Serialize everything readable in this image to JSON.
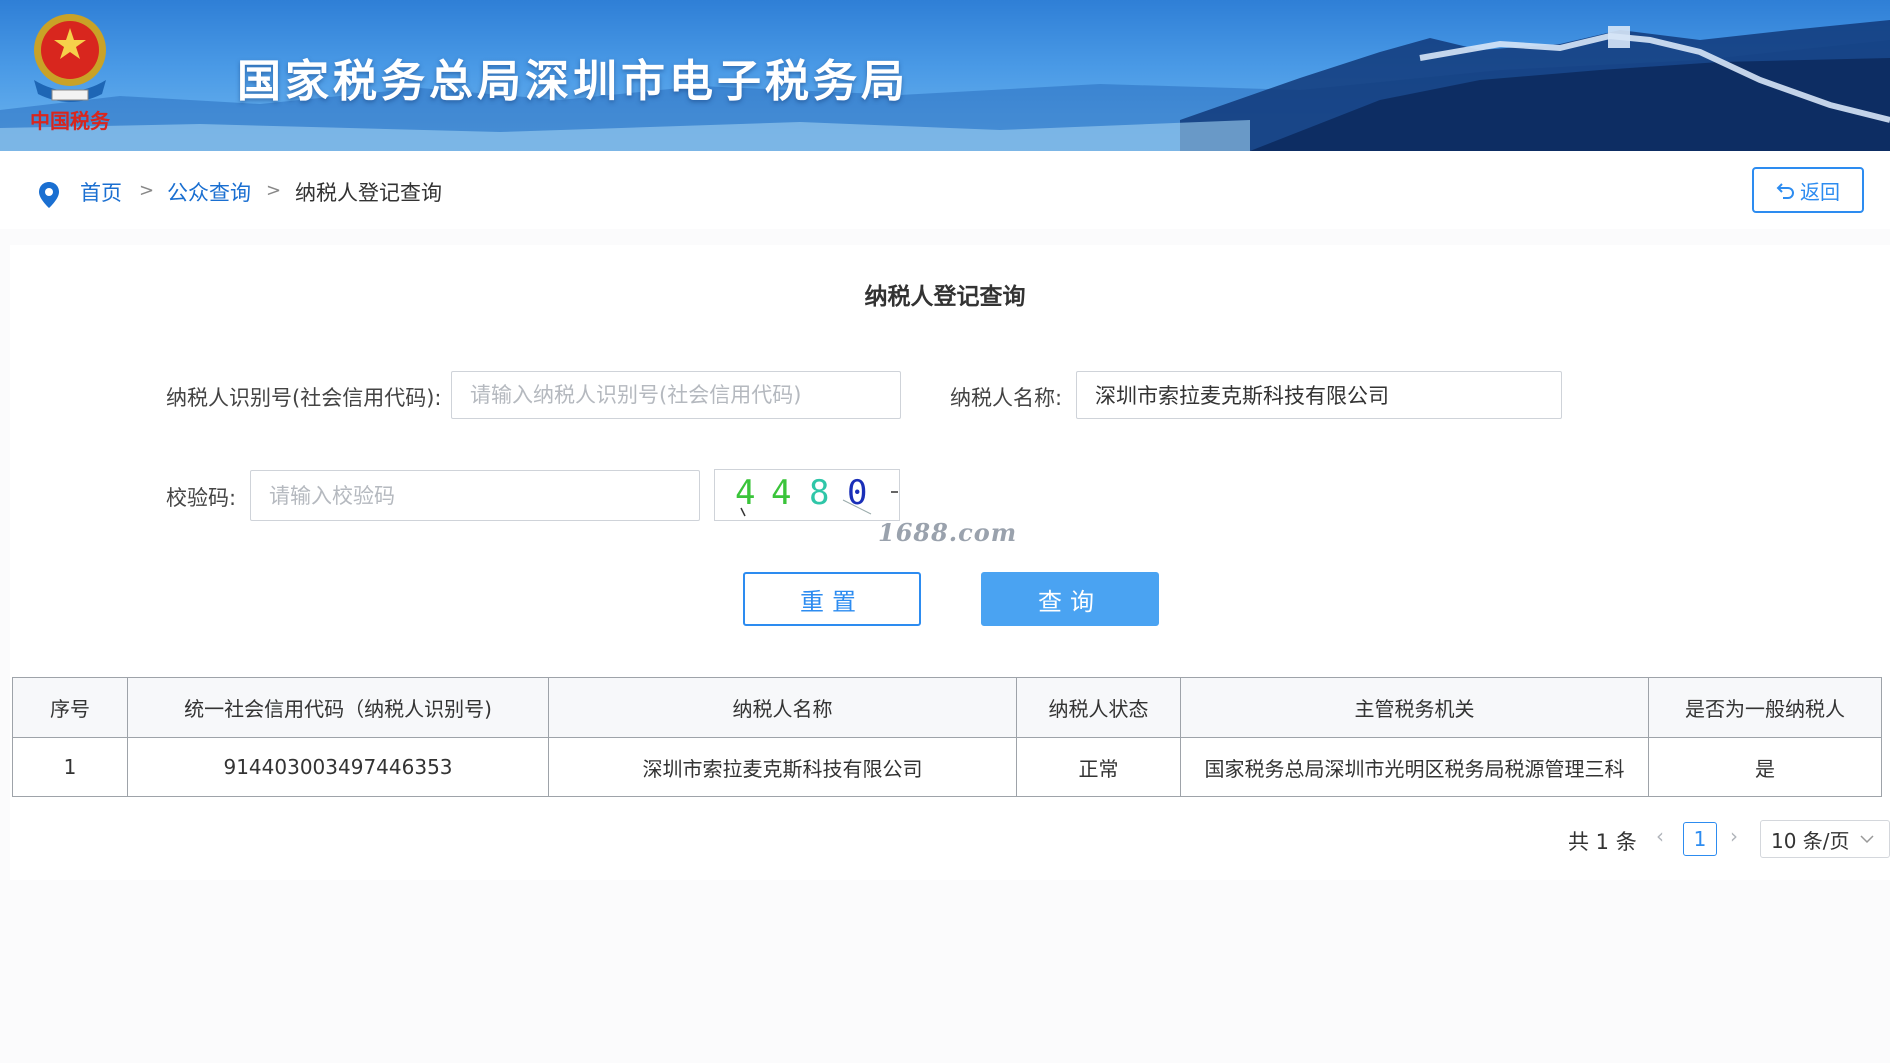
{
  "header": {
    "site_title": "国家税务总局深圳市电子税务局",
    "logo_text": "中国税务"
  },
  "breadcrumb": {
    "home": "首页",
    "separator": ">",
    "public_query": "公众查询",
    "current": "纳税人登记查询"
  },
  "back_button": {
    "label": "返回",
    "icon": "undo-arrow-icon"
  },
  "form": {
    "title": "纳税人登记查询",
    "taxpayer_id": {
      "label": "纳税人识别号(社会信用代码):",
      "placeholder": "请输入纳税人识别号(社会信用代码)",
      "value": ""
    },
    "taxpayer_name": {
      "label": "纳税人名称:",
      "placeholder": "",
      "value": "深圳市索拉麦克斯科技有限公司"
    },
    "captcha": {
      "label": "校验码:",
      "placeholder": "请输入校验码",
      "value": "",
      "image_digits": [
        "4",
        "4",
        "8",
        "0"
      ],
      "digit_colors": [
        "#3ac43a",
        "#3ac43a",
        "#2fc6a8",
        "#1a2fb8"
      ]
    },
    "watermark": "1688.com",
    "reset_label": "重置",
    "query_label": "查询"
  },
  "table": {
    "columns": [
      "序号",
      "统一社会信用代码（纳税人识别号)",
      "纳税人名称",
      "纳税人状态",
      "主管税务机关",
      "是否为一般纳税人"
    ],
    "rows": [
      [
        "1",
        "914403003497446353",
        "深圳市索拉麦克斯科技有限公司",
        "正常",
        "国家税务总局深圳市光明区税务局税源管理三科",
        "是"
      ]
    ]
  },
  "pagination": {
    "total_text": "共 1 条",
    "current_page": "1",
    "page_size": "10 条/页",
    "prev_icon": "chevron-left-icon",
    "next_icon": "chevron-right-icon"
  },
  "colors": {
    "accent": "#2d8cf0",
    "query_button": "#4aa3f2",
    "link": "#1a6fd1",
    "banner": "#3b8ee0"
  }
}
